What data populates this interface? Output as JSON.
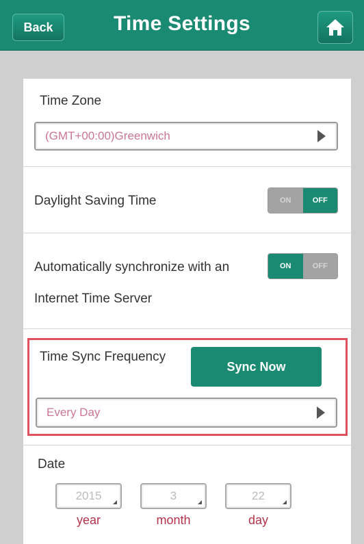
{
  "header": {
    "back_label": "Back",
    "title": "Time Settings",
    "home_icon": "home-icon"
  },
  "time_zone": {
    "label": "Time Zone",
    "value": "(GMT+00:00)Greenwich"
  },
  "daylight_saving": {
    "label": "Daylight Saving Time",
    "on_label": "ON",
    "off_label": "OFF",
    "state": "OFF"
  },
  "auto_sync": {
    "label_line1": "Automatically synchronize with an",
    "label_line2": "Internet Time Server",
    "on_label": "ON",
    "off_label": "OFF",
    "state": "ON"
  },
  "sync_frequency": {
    "label": "Time Sync Frequency",
    "sync_now_label": "Sync Now",
    "value": "Every Day"
  },
  "date": {
    "label": "Date",
    "year_value": "2015",
    "month_value": "3",
    "day_value": "22",
    "year_label": "year",
    "month_label": "month",
    "day_label": "day"
  },
  "colors": {
    "brand": "#1a8a72",
    "highlight_border": "#e0505f",
    "select_text": "#cc7593",
    "date_unit": "#b5324a"
  }
}
